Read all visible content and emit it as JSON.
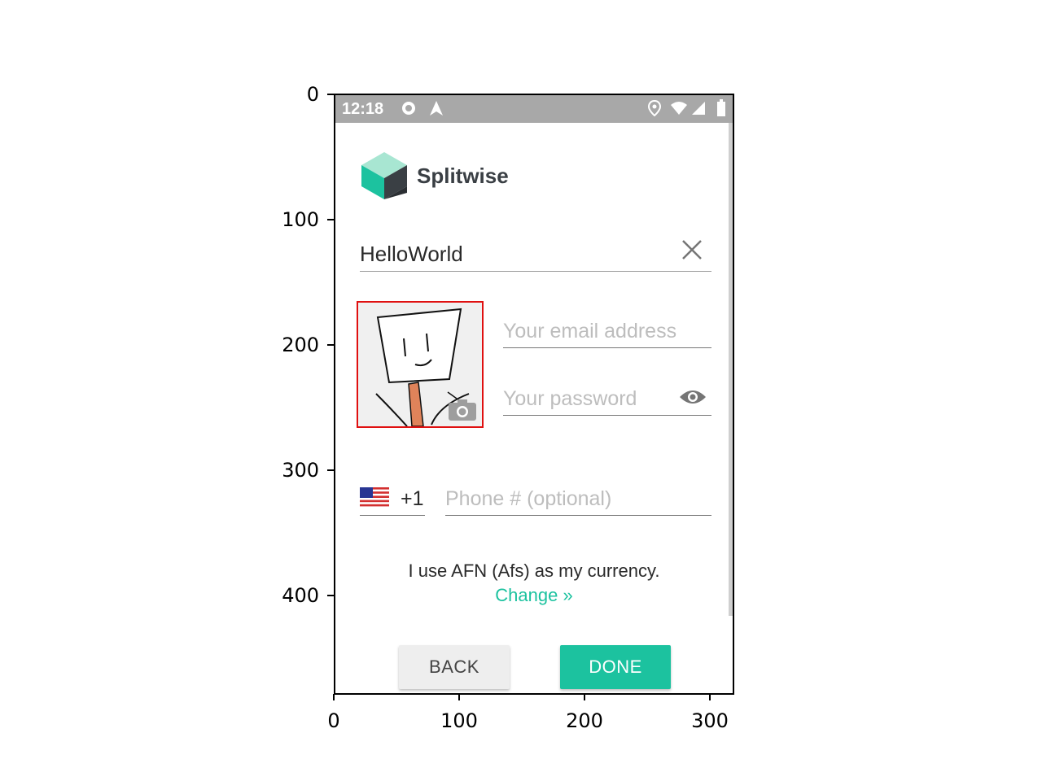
{
  "axes": {
    "y_ticks": [
      "0",
      "100",
      "200",
      "300",
      "400"
    ],
    "x_ticks": [
      "0",
      "100",
      "200",
      "300"
    ]
  },
  "status_bar": {
    "time": "12:18",
    "left_icons": [
      "settings-icon",
      "navigation-icon"
    ],
    "right_icons": [
      "location-icon",
      "wifi-icon",
      "signal-icon",
      "battery-icon"
    ]
  },
  "app": {
    "name": "Splitwise",
    "colors": {
      "accent": "#1cc29f",
      "highlight_border": "#e01010",
      "statusbar": "#a8a8a8"
    }
  },
  "form": {
    "name_value": "HelloWorld",
    "email_placeholder": "Your email address",
    "password_placeholder": "Your password",
    "country_code": "+1",
    "phone_placeholder": "Phone # (optional)"
  },
  "currency": {
    "text": "I use AFN (Afs) as my currency.",
    "change_label": "Change »"
  },
  "buttons": {
    "back_label": "BACK",
    "done_label": "DONE"
  }
}
